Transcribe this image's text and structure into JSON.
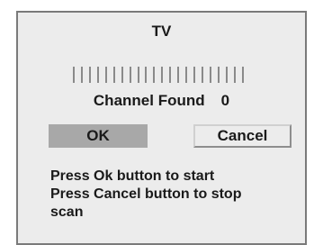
{
  "dialog": {
    "title": "TV",
    "progress": {
      "tick_count": 22
    },
    "channel_found_label": "Channel Found",
    "channel_found_count": "0",
    "ok_label": "OK",
    "cancel_label": "Cancel",
    "help_lines": [
      "Press Ok button to start",
      "Press Cancel button to stop",
      "scan"
    ]
  }
}
